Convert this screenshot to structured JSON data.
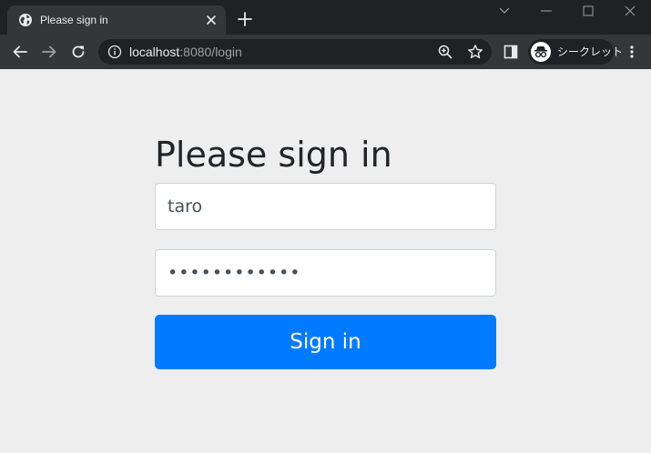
{
  "browser": {
    "tab": {
      "title": "Please sign in",
      "favicon": "globe-icon"
    },
    "toolbar": {
      "url_host": "localhost",
      "url_rest": ":8080/login",
      "incognito_label": "シークレット"
    },
    "icons": [
      "globe-icon",
      "close-icon",
      "plus-icon",
      "chevron-down-icon",
      "minimize-icon",
      "maximize-icon",
      "window-close-icon",
      "back-arrow-icon",
      "forward-arrow-icon",
      "reload-icon",
      "info-icon",
      "zoom-icon",
      "star-icon",
      "side-panel-icon",
      "incognito-icon",
      "kebab-menu-icon"
    ],
    "colors": {
      "titlebar": "#202124",
      "toolbar": "#35363a",
      "omnibox": "#202124"
    }
  },
  "login": {
    "heading": "Please sign in",
    "username_value": "taro",
    "password_value": "••••••••••••",
    "submit_label": "Sign in"
  },
  "colors": {
    "page_background": "#eeeeee",
    "button": "#007bff",
    "button_text": "#ffffff",
    "heading_text": "#212529"
  }
}
